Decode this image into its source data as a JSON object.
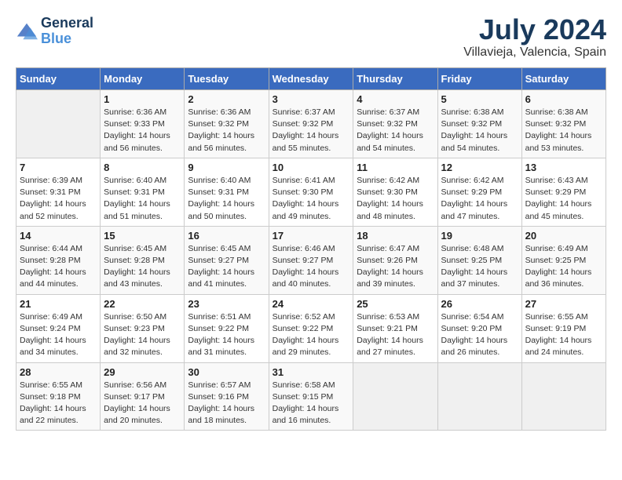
{
  "logo": {
    "line1": "General",
    "line2": "Blue"
  },
  "title": "July 2024",
  "subtitle": "Villavieja, Valencia, Spain",
  "days_of_week": [
    "Sunday",
    "Monday",
    "Tuesday",
    "Wednesday",
    "Thursday",
    "Friday",
    "Saturday"
  ],
  "weeks": [
    [
      {
        "day": "",
        "sunrise": "",
        "sunset": "",
        "daylight": ""
      },
      {
        "day": "1",
        "sunrise": "Sunrise: 6:36 AM",
        "sunset": "Sunset: 9:33 PM",
        "daylight": "Daylight: 14 hours and 56 minutes."
      },
      {
        "day": "2",
        "sunrise": "Sunrise: 6:36 AM",
        "sunset": "Sunset: 9:32 PM",
        "daylight": "Daylight: 14 hours and 56 minutes."
      },
      {
        "day": "3",
        "sunrise": "Sunrise: 6:37 AM",
        "sunset": "Sunset: 9:32 PM",
        "daylight": "Daylight: 14 hours and 55 minutes."
      },
      {
        "day": "4",
        "sunrise": "Sunrise: 6:37 AM",
        "sunset": "Sunset: 9:32 PM",
        "daylight": "Daylight: 14 hours and 54 minutes."
      },
      {
        "day": "5",
        "sunrise": "Sunrise: 6:38 AM",
        "sunset": "Sunset: 9:32 PM",
        "daylight": "Daylight: 14 hours and 54 minutes."
      },
      {
        "day": "6",
        "sunrise": "Sunrise: 6:38 AM",
        "sunset": "Sunset: 9:32 PM",
        "daylight": "Daylight: 14 hours and 53 minutes."
      }
    ],
    [
      {
        "day": "7",
        "sunrise": "Sunrise: 6:39 AM",
        "sunset": "Sunset: 9:31 PM",
        "daylight": "Daylight: 14 hours and 52 minutes."
      },
      {
        "day": "8",
        "sunrise": "Sunrise: 6:40 AM",
        "sunset": "Sunset: 9:31 PM",
        "daylight": "Daylight: 14 hours and 51 minutes."
      },
      {
        "day": "9",
        "sunrise": "Sunrise: 6:40 AM",
        "sunset": "Sunset: 9:31 PM",
        "daylight": "Daylight: 14 hours and 50 minutes."
      },
      {
        "day": "10",
        "sunrise": "Sunrise: 6:41 AM",
        "sunset": "Sunset: 9:30 PM",
        "daylight": "Daylight: 14 hours and 49 minutes."
      },
      {
        "day": "11",
        "sunrise": "Sunrise: 6:42 AM",
        "sunset": "Sunset: 9:30 PM",
        "daylight": "Daylight: 14 hours and 48 minutes."
      },
      {
        "day": "12",
        "sunrise": "Sunrise: 6:42 AM",
        "sunset": "Sunset: 9:29 PM",
        "daylight": "Daylight: 14 hours and 47 minutes."
      },
      {
        "day": "13",
        "sunrise": "Sunrise: 6:43 AM",
        "sunset": "Sunset: 9:29 PM",
        "daylight": "Daylight: 14 hours and 45 minutes."
      }
    ],
    [
      {
        "day": "14",
        "sunrise": "Sunrise: 6:44 AM",
        "sunset": "Sunset: 9:28 PM",
        "daylight": "Daylight: 14 hours and 44 minutes."
      },
      {
        "day": "15",
        "sunrise": "Sunrise: 6:45 AM",
        "sunset": "Sunset: 9:28 PM",
        "daylight": "Daylight: 14 hours and 43 minutes."
      },
      {
        "day": "16",
        "sunrise": "Sunrise: 6:45 AM",
        "sunset": "Sunset: 9:27 PM",
        "daylight": "Daylight: 14 hours and 41 minutes."
      },
      {
        "day": "17",
        "sunrise": "Sunrise: 6:46 AM",
        "sunset": "Sunset: 9:27 PM",
        "daylight": "Daylight: 14 hours and 40 minutes."
      },
      {
        "day": "18",
        "sunrise": "Sunrise: 6:47 AM",
        "sunset": "Sunset: 9:26 PM",
        "daylight": "Daylight: 14 hours and 39 minutes."
      },
      {
        "day": "19",
        "sunrise": "Sunrise: 6:48 AM",
        "sunset": "Sunset: 9:25 PM",
        "daylight": "Daylight: 14 hours and 37 minutes."
      },
      {
        "day": "20",
        "sunrise": "Sunrise: 6:49 AM",
        "sunset": "Sunset: 9:25 PM",
        "daylight": "Daylight: 14 hours and 36 minutes."
      }
    ],
    [
      {
        "day": "21",
        "sunrise": "Sunrise: 6:49 AM",
        "sunset": "Sunset: 9:24 PM",
        "daylight": "Daylight: 14 hours and 34 minutes."
      },
      {
        "day": "22",
        "sunrise": "Sunrise: 6:50 AM",
        "sunset": "Sunset: 9:23 PM",
        "daylight": "Daylight: 14 hours and 32 minutes."
      },
      {
        "day": "23",
        "sunrise": "Sunrise: 6:51 AM",
        "sunset": "Sunset: 9:22 PM",
        "daylight": "Daylight: 14 hours and 31 minutes."
      },
      {
        "day": "24",
        "sunrise": "Sunrise: 6:52 AM",
        "sunset": "Sunset: 9:22 PM",
        "daylight": "Daylight: 14 hours and 29 minutes."
      },
      {
        "day": "25",
        "sunrise": "Sunrise: 6:53 AM",
        "sunset": "Sunset: 9:21 PM",
        "daylight": "Daylight: 14 hours and 27 minutes."
      },
      {
        "day": "26",
        "sunrise": "Sunrise: 6:54 AM",
        "sunset": "Sunset: 9:20 PM",
        "daylight": "Daylight: 14 hours and 26 minutes."
      },
      {
        "day": "27",
        "sunrise": "Sunrise: 6:55 AM",
        "sunset": "Sunset: 9:19 PM",
        "daylight": "Daylight: 14 hours and 24 minutes."
      }
    ],
    [
      {
        "day": "28",
        "sunrise": "Sunrise: 6:55 AM",
        "sunset": "Sunset: 9:18 PM",
        "daylight": "Daylight: 14 hours and 22 minutes."
      },
      {
        "day": "29",
        "sunrise": "Sunrise: 6:56 AM",
        "sunset": "Sunset: 9:17 PM",
        "daylight": "Daylight: 14 hours and 20 minutes."
      },
      {
        "day": "30",
        "sunrise": "Sunrise: 6:57 AM",
        "sunset": "Sunset: 9:16 PM",
        "daylight": "Daylight: 14 hours and 18 minutes."
      },
      {
        "day": "31",
        "sunrise": "Sunrise: 6:58 AM",
        "sunset": "Sunset: 9:15 PM",
        "daylight": "Daylight: 14 hours and 16 minutes."
      },
      {
        "day": "",
        "sunrise": "",
        "sunset": "",
        "daylight": ""
      },
      {
        "day": "",
        "sunrise": "",
        "sunset": "",
        "daylight": ""
      },
      {
        "day": "",
        "sunrise": "",
        "sunset": "",
        "daylight": ""
      }
    ]
  ]
}
